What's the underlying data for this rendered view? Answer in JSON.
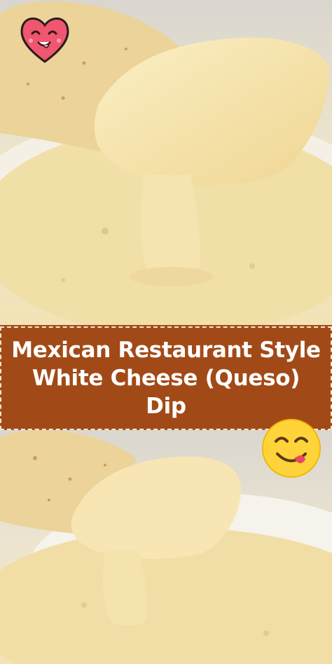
{
  "banner": {
    "title_line1": "Mexican Restaurant Style",
    "title_line2": "White Cheese (Queso)",
    "title_line3": "Dip"
  },
  "colors": {
    "banner_bg": "#a24a17",
    "banner_text": "#ffffff",
    "queso": "#f4e3ad",
    "chip": "#efd8a0",
    "heart": "#f0566f",
    "emoji": "#ffd43b"
  },
  "stickers": {
    "heart": "heart-face-icon",
    "emoji": "yum-face-emoji-icon"
  }
}
